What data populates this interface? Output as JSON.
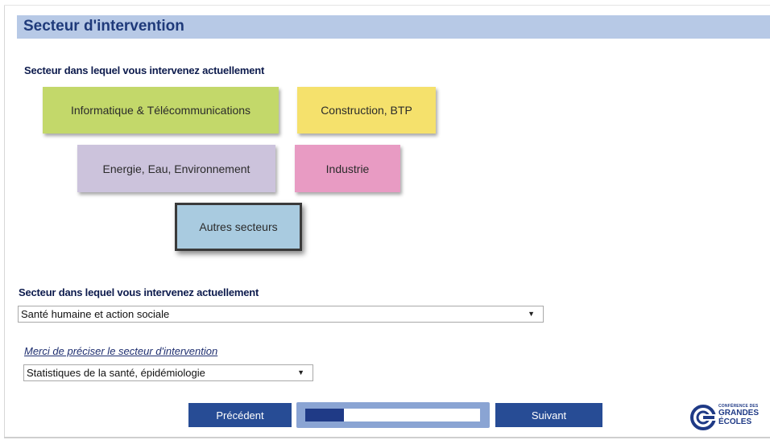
{
  "header": {
    "title": "Secteur d'intervention"
  },
  "question1": {
    "label": "Secteur dans lequel vous intervenez actuellement"
  },
  "tiles": [
    {
      "label": "Informatique & Télécommunications",
      "color": "#c3d86a"
    },
    {
      "label": "Construction, BTP",
      "color": "#f5e16c"
    },
    {
      "label": "Energie, Eau, Environnement",
      "color": "#ccc3dc"
    },
    {
      "label": "Industrie",
      "color": "#e89bc3"
    },
    {
      "label": "Autres secteurs",
      "color": "#a9cbe0",
      "selected": true
    }
  ],
  "question2": {
    "label": "Secteur dans lequel vous intervenez actuellement",
    "selected": "Santé humaine et action sociale"
  },
  "question3": {
    "label": "Merci de préciser le secteur d'intervention",
    "selected": "Statistiques de la santé, épidémiologie"
  },
  "nav": {
    "previous_label": "Précédent",
    "next_label": "Suivant"
  },
  "progress": {
    "fraction": 0.22
  },
  "logo": {
    "line1": "CONFÉRENCE DES",
    "line2": "GRANDES",
    "line3": "ÉCOLES"
  },
  "icons": {
    "dropdown": "▼"
  },
  "colors": {
    "header_bg": "#b7c9e6",
    "title": "#1f3a7a",
    "button": "#274c95",
    "progress_fill": "#1f3a86"
  }
}
